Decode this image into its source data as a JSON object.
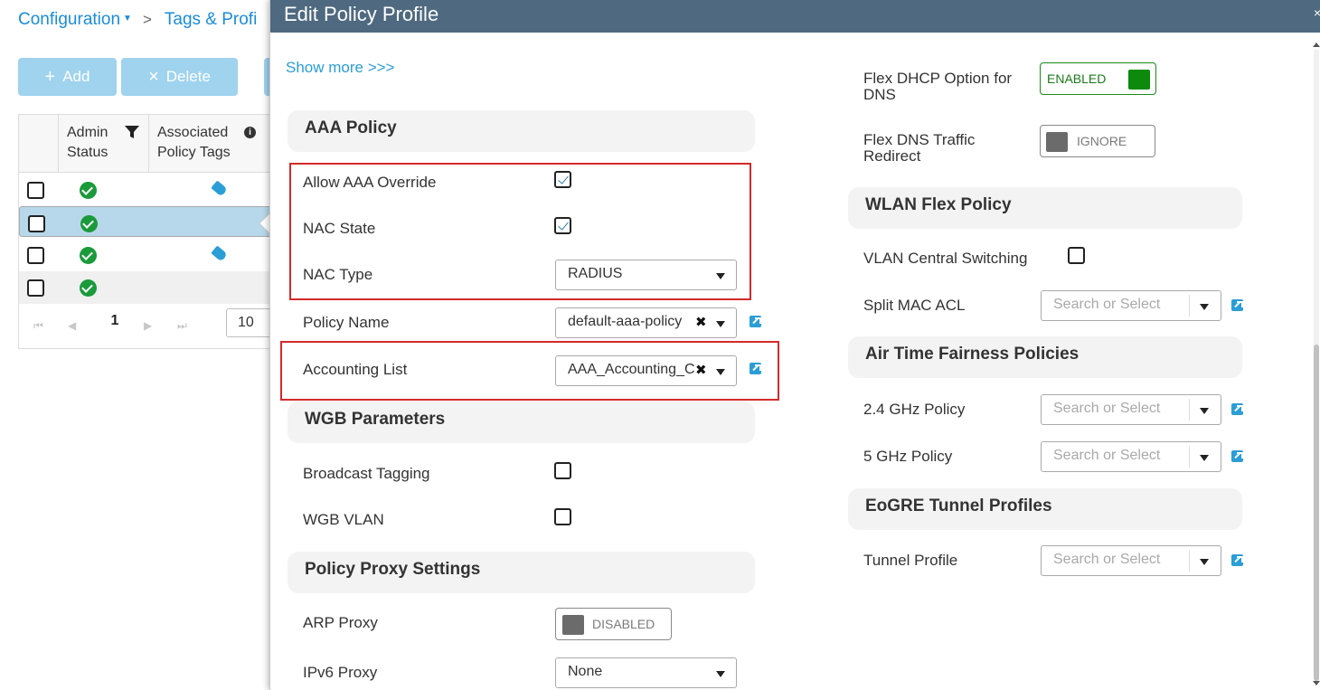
{
  "background": {
    "breadcrumb": {
      "root": "Configuration",
      "separator": ">",
      "current": "Tags & Profi"
    },
    "toolbar": {
      "add_label": "Add",
      "delete_label": "Delete"
    },
    "table": {
      "headers": {
        "admin_status": "Admin Status",
        "associated_policy_tags": "Associated Policy Tags"
      },
      "pager": {
        "first": "⏮",
        "prev": "◀",
        "current_page": "1",
        "next": "▶",
        "last": "⏭",
        "page_size": "10"
      }
    }
  },
  "modal": {
    "title": "Edit Policy Profile",
    "close": "×",
    "show_more": "Show more >>>",
    "left": {
      "aaa_policy": {
        "title": "AAA Policy",
        "allow_aaa_override_label": "Allow AAA Override",
        "allow_aaa_override_checked": true,
        "nac_state_label": "NAC State",
        "nac_state_checked": true,
        "nac_type_label": "NAC Type",
        "nac_type_value": "RADIUS",
        "policy_name_label": "Policy Name",
        "policy_name_value": "default-aaa-policy",
        "accounting_list_label": "Accounting List",
        "accounting_list_value": "AAA_Accounting_C"
      },
      "wgb_parameters": {
        "title": "WGB Parameters",
        "broadcast_tagging_label": "Broadcast Tagging",
        "wgb_vlan_label": "WGB VLAN"
      },
      "policy_proxy": {
        "title": "Policy Proxy Settings",
        "arp_proxy_label": "ARP Proxy",
        "arp_proxy_state": "DISABLED",
        "ipv6_proxy_label": "IPv6 Proxy",
        "ipv6_proxy_value": "None"
      }
    },
    "right": {
      "flex_dhcp_option_dns_label": "Flex DHCP Option for DNS",
      "flex_dhcp_option_dns_state": "ENABLED",
      "flex_dns_traffic_redirect_label": "Flex DNS Traffic Redirect",
      "flex_dns_traffic_redirect_state": "IGNORE",
      "wlan_flex_policy": {
        "title": "WLAN Flex Policy",
        "vlan_central_switching_label": "VLAN Central Switching",
        "split_mac_acl_label": "Split MAC ACL",
        "split_mac_acl_placeholder": "Search or Select"
      },
      "air_time_fairness": {
        "title": "Air Time Fairness Policies",
        "ghz24_label": "2.4 GHz Policy",
        "ghz24_placeholder": "Search or Select",
        "ghz5_label": "5 GHz Policy",
        "ghz5_placeholder": "Search or Select"
      },
      "eogre": {
        "title": "EoGRE Tunnel Profiles",
        "tunnel_profile_label": "Tunnel Profile",
        "tunnel_profile_placeholder": "Search or Select"
      }
    }
  },
  "colors": {
    "header_bg": "#4f6a80",
    "link": "#2a9ed6",
    "enabled_green": "#0b8a0b",
    "highlight_red": "#d42a2a",
    "selected_row": "#b7d8ea"
  }
}
